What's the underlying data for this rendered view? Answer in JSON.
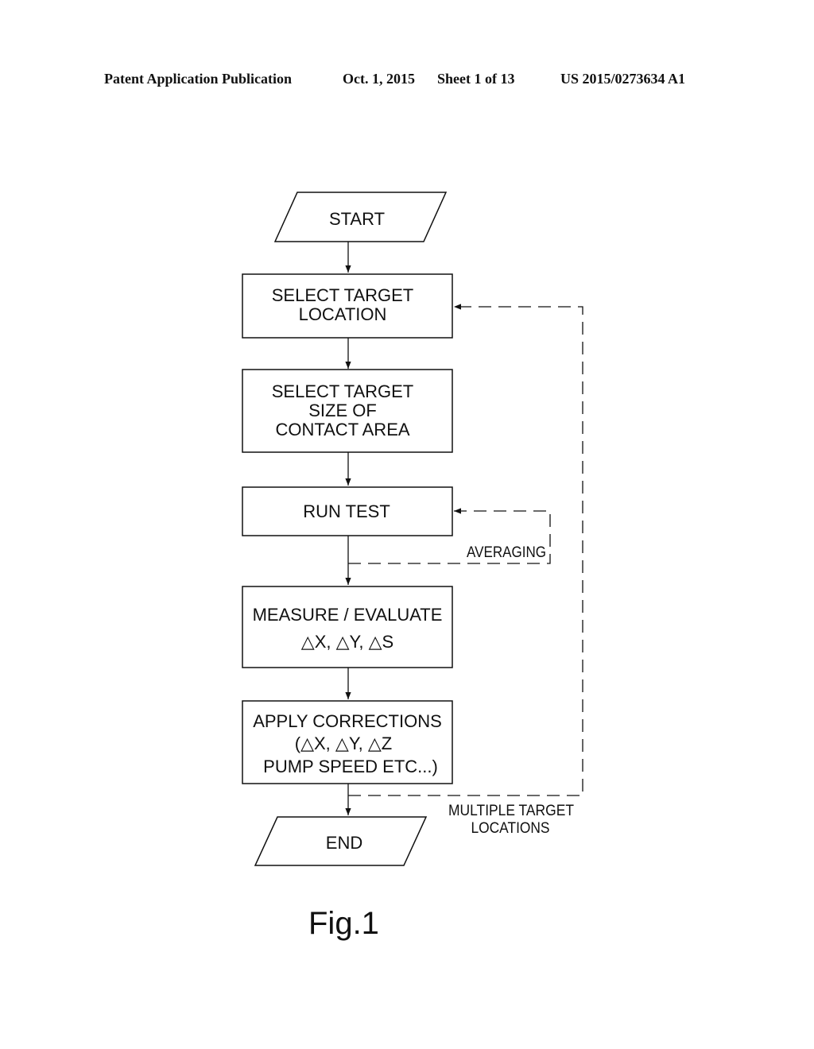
{
  "header": {
    "publication": "Patent Application Publication",
    "date": "Oct. 1, 2015",
    "sheet": "Sheet 1 of 13",
    "patent_number": "US 2015/0273634 A1"
  },
  "flowchart": {
    "nodes": {
      "start": "START",
      "select_location": [
        "SELECT TARGET",
        "LOCATION"
      ],
      "select_size": [
        "SELECT TARGET",
        "SIZE OF",
        "CONTACT AREA"
      ],
      "run_test": "RUN TEST",
      "measure": [
        "MEASURE / EVALUATE",
        "△X,  △Y,  △S"
      ],
      "apply": [
        "APPLY CORRECTIONS",
        "(△X,  △Y,  △Z",
        "PUMP SPEED ETC...)"
      ],
      "end": "END"
    },
    "loops": {
      "averaging": "AVERAGING",
      "multiple": [
        "MULTIPLE TARGET",
        "LOCATIONS"
      ]
    }
  },
  "figure_label": "Fig.1"
}
